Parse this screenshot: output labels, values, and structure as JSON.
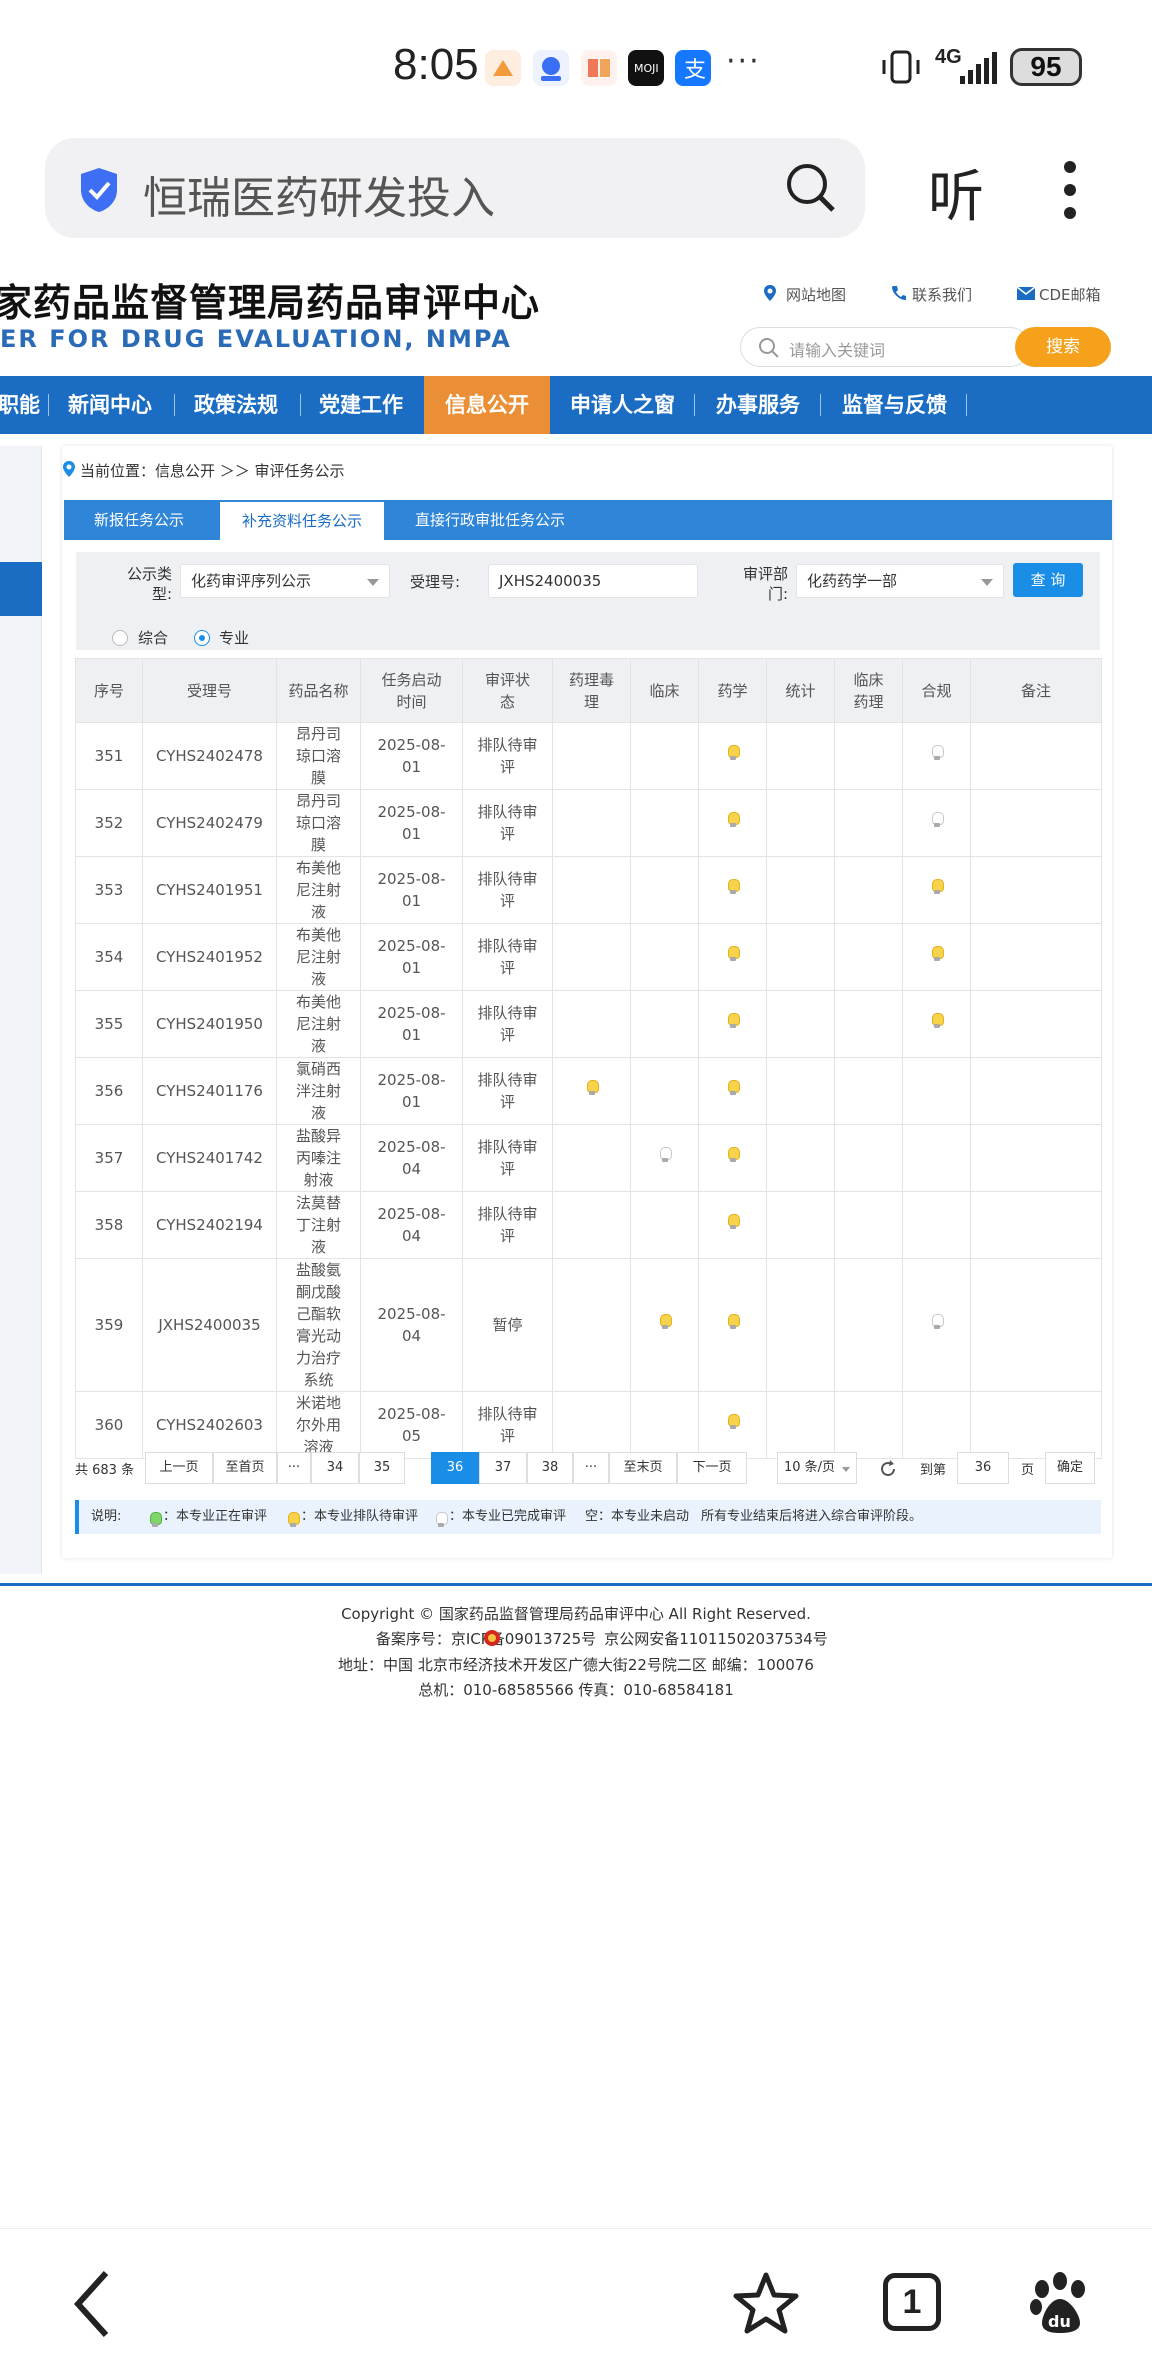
{
  "status_bar": {
    "time": "8:05",
    "network": "4G",
    "battery": "95"
  },
  "browser": {
    "search_query": "恒瑞医药研发投入",
    "listen_label": "听"
  },
  "site": {
    "title": "家药品监督管理局药品审评中心",
    "subtitle": "ER FOR DRUG EVALUATION, NMPA",
    "links": [
      "网站地图",
      "联系我们",
      "CDE邮箱"
    ],
    "keyword_placeholder": "请输入关键词",
    "search_button": "搜索"
  },
  "nav": {
    "items": [
      "职能",
      "新闻中心",
      "政策法规",
      "党建工作",
      "信息公开",
      "申请人之窗",
      "办事服务",
      "监督与反馈"
    ],
    "active": "信息公开"
  },
  "breadcrumb": "当前位置：信息公开 ＞＞ 审评任务公示",
  "tabs": [
    "新报任务公示",
    "补充资料任务公示",
    "直接行政审批任务公示"
  ],
  "filter": {
    "type_label": "公示类型:",
    "type_value": "化药审评序列公示",
    "accept_label": "受理号:",
    "accept_value": "JXHS2400035",
    "dept_label": "审评部门:",
    "dept_value": "化药药学一部",
    "query_button": "查 询",
    "radio_all": "综合",
    "radio_pro": "专业"
  },
  "table": {
    "headers": [
      "序号",
      "受理号",
      "药品名称",
      "任务启动时间",
      "审评状态",
      "药理毒理",
      "临床",
      "药学",
      "统计",
      "临床药理",
      "合规",
      "备注"
    ],
    "rows": [
      {
        "no": "351",
        "id": "CYHS2402478",
        "name": "昂丹司琼口溶膜",
        "date": "2025-08-01",
        "status": "排队待审评",
        "marks": [
          "",
          "",
          "y",
          "",
          "",
          "g"
        ]
      },
      {
        "no": "352",
        "id": "CYHS2402479",
        "name": "昂丹司琼口溶膜",
        "date": "2025-08-01",
        "status": "排队待审评",
        "marks": [
          "",
          "",
          "y",
          "",
          "",
          "g"
        ]
      },
      {
        "no": "353",
        "id": "CYHS2401951",
        "name": "布美他尼注射液",
        "date": "2025-08-01",
        "status": "排队待审评",
        "marks": [
          "",
          "",
          "y",
          "",
          "",
          "y"
        ]
      },
      {
        "no": "354",
        "id": "CYHS2401952",
        "name": "布美他尼注射液",
        "date": "2025-08-01",
        "status": "排队待审评",
        "marks": [
          "",
          "",
          "y",
          "",
          "",
          "y"
        ]
      },
      {
        "no": "355",
        "id": "CYHS2401950",
        "name": "布美他尼注射液",
        "date": "2025-08-01",
        "status": "排队待审评",
        "marks": [
          "",
          "",
          "y",
          "",
          "",
          "y"
        ]
      },
      {
        "no": "356",
        "id": "CYHS2401176",
        "name": "氯硝西泮注射液",
        "date": "2025-08-01",
        "status": "排队待审评",
        "marks": [
          "y",
          "",
          "y",
          "",
          "",
          ""
        ]
      },
      {
        "no": "357",
        "id": "CYHS2401742",
        "name": "盐酸异丙嗪注射液",
        "date": "2025-08-04",
        "status": "排队待审评",
        "marks": [
          "",
          "g",
          "y",
          "",
          "",
          ""
        ]
      },
      {
        "no": "358",
        "id": "CYHS2402194",
        "name": "法莫替丁注射液",
        "date": "2025-08-04",
        "status": "排队待审评",
        "marks": [
          "",
          "",
          "y",
          "",
          "",
          ""
        ]
      },
      {
        "no": "359",
        "id": "JXHS2400035",
        "name": "盐酸氨酮戊酸己酯软膏光动力治疗系统",
        "date": "2025-08-04",
        "status": "暂停",
        "marks": [
          "",
          "y",
          "y",
          "",
          "",
          "g"
        ]
      },
      {
        "no": "360",
        "id": "CYHS2402603",
        "name": "米诺地尔外用溶液",
        "date": "2025-08-05",
        "status": "排队待审评",
        "marks": [
          "",
          "",
          "y",
          "",
          "",
          ""
        ]
      }
    ]
  },
  "pager": {
    "total": "共 683 条",
    "prev": "上一页",
    "first": "至首页",
    "ellipsis": "···",
    "pages": [
      "34",
      "35",
      "36",
      "37",
      "38"
    ],
    "current": "36",
    "last": "至末页",
    "next": "下一页",
    "page_size": "10 条/页",
    "goto_label": "到第",
    "goto_value": "36",
    "page_unit": "页",
    "confirm": "确定"
  },
  "legend": {
    "label": "说明:",
    "green": "：本专业正在审评",
    "yellow": "：本专业排队待审评",
    "grey": "：本专业已完成审评",
    "empty": "空：本专业未启动",
    "note": "所有专业结束后将进入综合审评阶段。"
  },
  "footer": {
    "copyright": "Copyright © 国家药品监督管理局药品审评中心   All Right Reserved.",
    "icp": "备案序号：京ICP备09013725号",
    "police": "京公网安备11011502037534号",
    "address": "地址：中国 北京市经济技术开发区广德大街22号院二区      邮编：100076",
    "phone": "总机：010-68585566      传真：010-68584181"
  },
  "bottom_nav": {
    "tab_count": "1"
  },
  "colors": {
    "nav_blue": "#1a6dc3",
    "nav_active": "#ea8f35",
    "search_orange": "#f5a11c",
    "link_red": "#c8102e"
  }
}
